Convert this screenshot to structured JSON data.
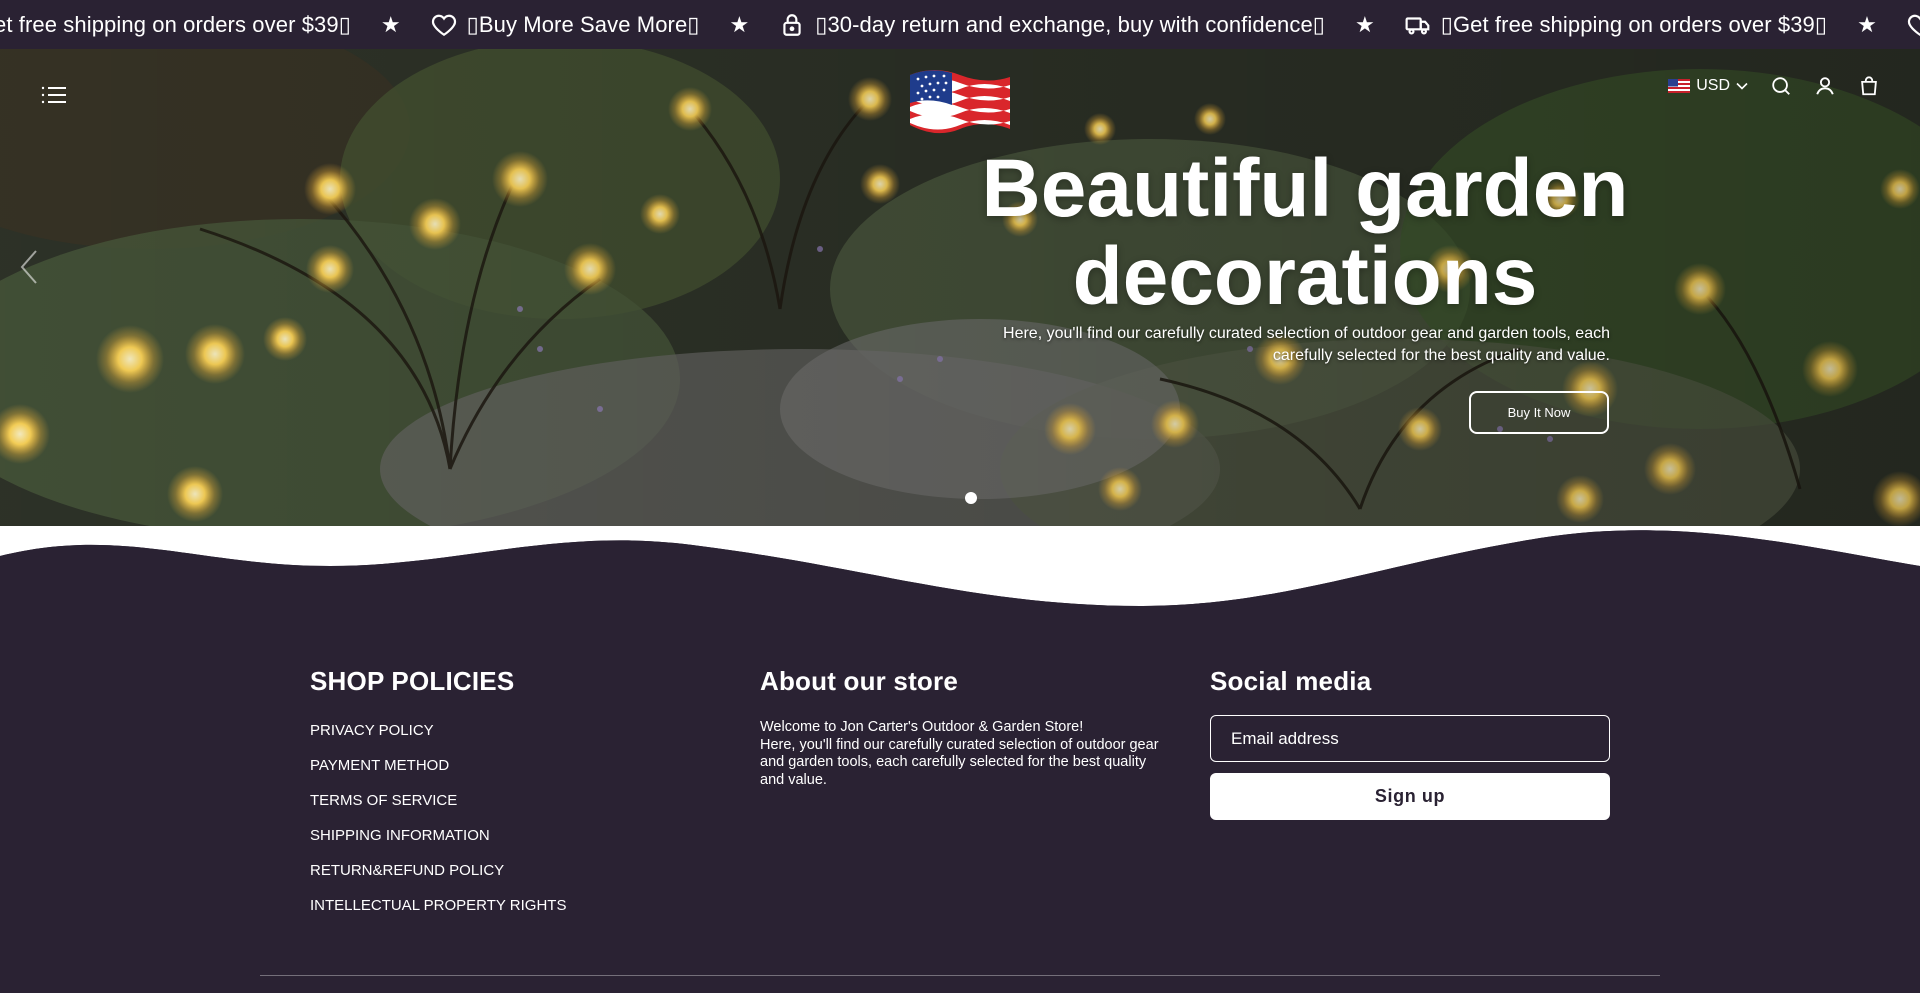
{
  "announcement": {
    "items": [
      {
        "icon": "truck-icon",
        "text": "et free shipping on orders over $39▯",
        "show_icon": false
      },
      {
        "icon": "heart-icon",
        "text": "▯Buy More Save More▯",
        "show_icon": true
      },
      {
        "icon": "lock-icon",
        "text": "▯30-day return and exchange, buy with confidence▯",
        "show_icon": true
      },
      {
        "icon": "truck-icon",
        "text": "▯Get free shipping on orders over $39▯",
        "show_icon": true
      }
    ],
    "separator": "★"
  },
  "header": {
    "currency": "USD",
    "icons": [
      "menu-icon",
      "search-icon",
      "account-icon",
      "cart-icon"
    ]
  },
  "hero": {
    "title_line1": "Beautiful garden",
    "title_line2": "decorations",
    "subtitle": "Here, you'll find our carefully curated selection of outdoor gear and garden tools, each carefully selected for the best quality and value.",
    "button_label": "Buy It Now"
  },
  "footer": {
    "policies": {
      "title": "SHOP POLICIES",
      "items": [
        "PRIVACY POLICY",
        "PAYMENT METHOD",
        "TERMS OF SERVICE",
        "SHIPPING INFORMATION",
        "RETURN&REFUND POLICY",
        "INTELLECTUAL PROPERTY RIGHTS"
      ]
    },
    "about": {
      "title": "About our store",
      "line1": "Welcome to Jon Carter's Outdoor & Garden Store!",
      "line2": "Here, you'll find our carefully curated selection of outdoor gear and garden tools, each carefully selected for the best quality and value."
    },
    "social": {
      "title": "Social media",
      "email_placeholder": "Email address",
      "signup_label": "Sign up"
    }
  },
  "colors": {
    "background": "#2a2233",
    "text": "#ffffff",
    "button_bg": "#ffffff"
  }
}
